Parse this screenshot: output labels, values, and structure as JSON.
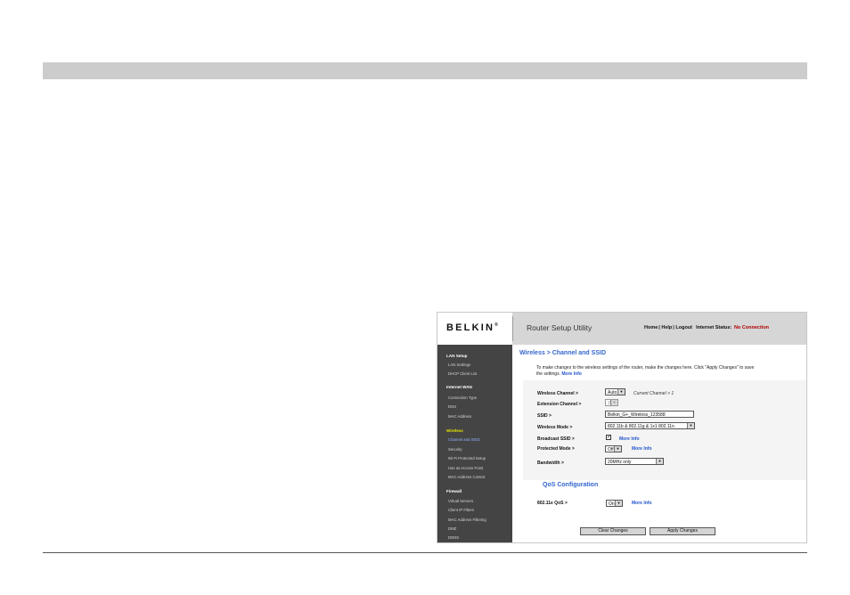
{
  "header": {
    "logo": "BELKIN",
    "logo_mark": "®",
    "app_title": "Router Setup Utility",
    "home": "Home",
    "help": "Help",
    "logout": "Logout",
    "status_label": "Internet Status:",
    "status_value": "No Connection"
  },
  "sidebar": {
    "lan": {
      "title": "LAN Setup",
      "items": [
        "LAN Settings",
        "DHCP Client List"
      ]
    },
    "wan": {
      "title": "Internet WAN",
      "items": [
        "Connection Type",
        "DNS",
        "MAC Address"
      ]
    },
    "wireless": {
      "title": "Wireless",
      "items": [
        "Channel and SSID",
        "Security",
        "Wi-Fi Protected Setup",
        "Use as Access Point",
        "MAC Address Control"
      ]
    },
    "firewall": {
      "title": "Firewall",
      "items": [
        "Virtual Servers",
        "Client IP Filters",
        "MAC Address Filtering",
        "DMZ",
        "DDNS"
      ]
    }
  },
  "main": {
    "title": "Wireless > Channel and SSID",
    "intro": "To make changes to the wireless settings of the router, make the changes here. Click \"Apply Changes\" to save the settings.",
    "intro_link": "More Info",
    "form": {
      "channel_label": "Wireless Channel >",
      "channel_value": "Auto",
      "current_channel": "Current Channel > 1",
      "ext_channel_label": "Extension Channel >",
      "ext_channel_value": "2",
      "ssid_label": "SSID >",
      "ssid_value": "Belkin_G+_Wireless_123588",
      "mode_label": "Wireless Mode >",
      "mode_value": "802.11b & 802.11g & 1x1 802.11n",
      "broadcast_label": "Broadcast SSID >",
      "broadcast_checked": true,
      "broadcast_more": "More Info",
      "protected_label": "Protected Mode >",
      "protected_value": "Off",
      "protected_more": "More Info",
      "bandwidth_label": "Bandwidth >",
      "bandwidth_value": "20MHz only"
    },
    "qos": {
      "title": "QoS Configuration",
      "label": "802.11e QoS >",
      "value": "On",
      "more": "More Info"
    },
    "buttons": {
      "clear": "Clear Changes",
      "apply": "Apply Changes"
    }
  }
}
